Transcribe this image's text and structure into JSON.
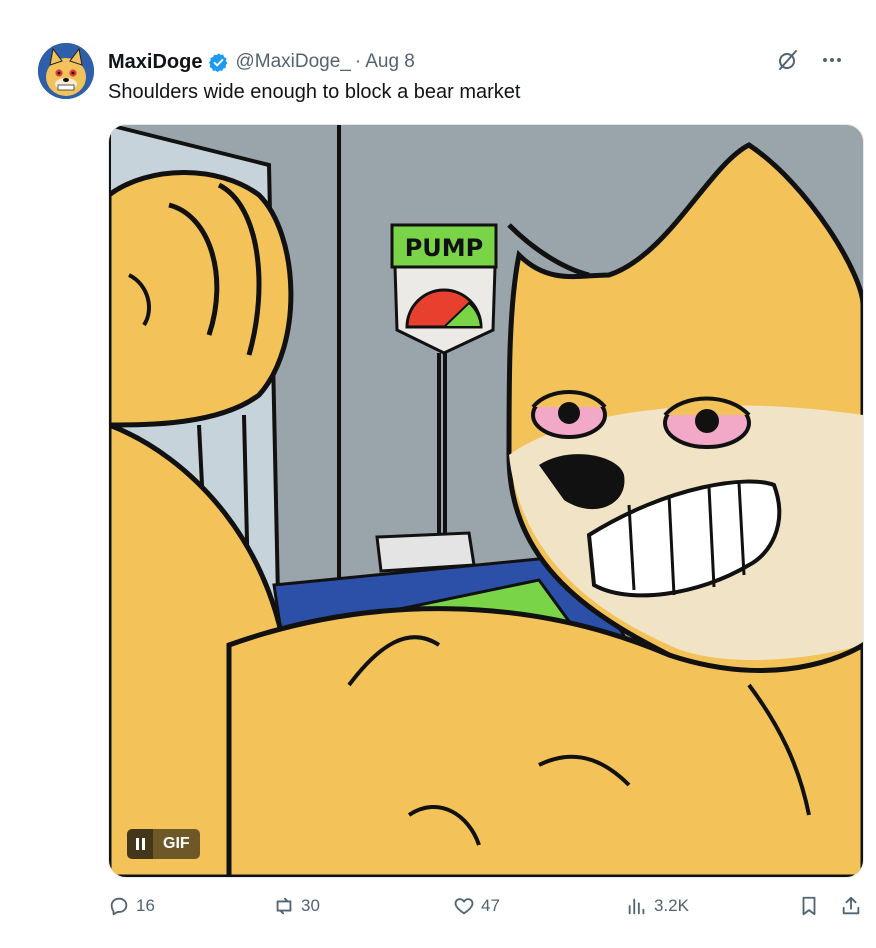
{
  "tweet": {
    "author_name": "MaxiDoge",
    "handle": "@MaxiDoge_",
    "separator": "·",
    "date": "Aug 8",
    "text": "Shoulders wide enough to block a bear market",
    "verified_color": "#1d9bf0"
  },
  "media": {
    "badge_label": "GIF",
    "sign_text": "PUMP",
    "icons": [
      "pause-icon"
    ]
  },
  "actions": {
    "replies": "16",
    "reposts": "30",
    "likes": "47",
    "views": "3.2K"
  },
  "icons": [
    "grok-icon",
    "more-icon",
    "reply-icon",
    "repost-icon",
    "like-icon",
    "views-icon",
    "bookmark-icon",
    "share-icon"
  ]
}
